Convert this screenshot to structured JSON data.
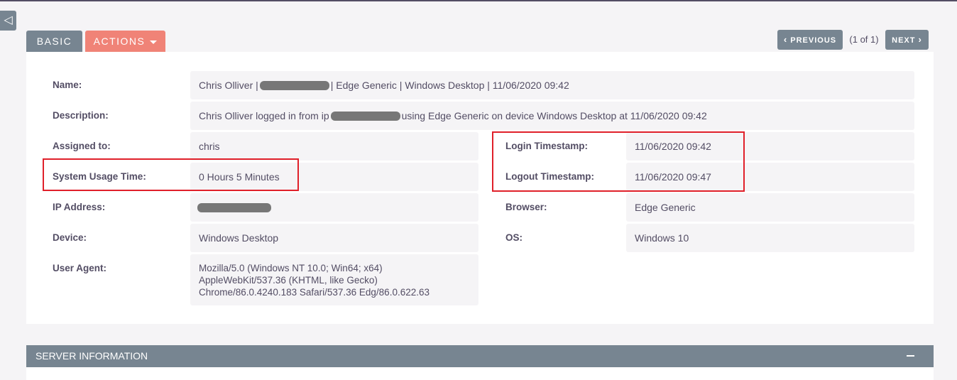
{
  "header": {
    "collapse_icon": "◁",
    "tabs": {
      "basic": "BASIC",
      "actions": "ACTIONS"
    },
    "pager": {
      "previous": "PREVIOUS",
      "next": "NEXT",
      "count": "(1 of 1)"
    }
  },
  "fields": {
    "name": {
      "label": "Name:",
      "value_before": "Chris Olliver |",
      "value_after": "| Edge Generic | Windows Desktop | 11/06/2020 09:42"
    },
    "description": {
      "label": "Description:",
      "value_before": "Chris Olliver logged in from ip",
      "value_after": "using Edge Generic on device Windows Desktop at 11/06/2020 09:42"
    },
    "assigned_to": {
      "label": "Assigned to:",
      "value": "chris"
    },
    "system_usage_time": {
      "label": "System Usage Time:",
      "value": "0 Hours 5 Minutes"
    },
    "ip_address": {
      "label": "IP Address:"
    },
    "device": {
      "label": "Device:",
      "value": "Windows Desktop"
    },
    "user_agent": {
      "label": "User Agent:",
      "lines": [
        "Mozilla/5.0 (Windows NT 10.0; Win64; x64)",
        "AppleWebKit/537.36 (KHTML, like Gecko)",
        "Chrome/86.0.4240.183 Safari/537.36 Edg/86.0.622.63"
      ]
    },
    "login_timestamp": {
      "label": "Login Timestamp:",
      "value": "11/06/2020 09:42"
    },
    "logout_timestamp": {
      "label": "Logout Timestamp:",
      "value": "11/06/2020 09:47"
    },
    "browser": {
      "label": "Browser:",
      "value": "Edge Generic"
    },
    "os": {
      "label": "OS:",
      "value": "Windows 10"
    }
  },
  "server_section": {
    "title": "SERVER INFORMATION"
  },
  "colors": {
    "tab_basic": "#778591",
    "tab_actions": "#f08377",
    "highlight": "#e0202a",
    "field_bg": "#f5f4f6",
    "text": "#534d64"
  }
}
